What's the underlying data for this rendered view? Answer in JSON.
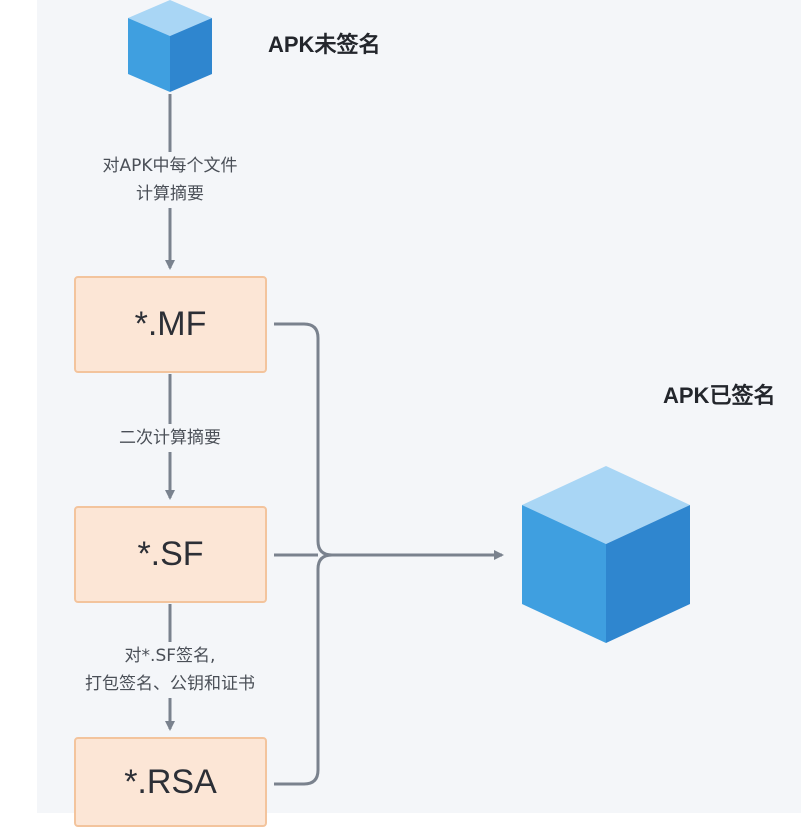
{
  "titles": {
    "unsigned": "APK未签名",
    "signed": "APK已签名"
  },
  "boxes": {
    "mf": "*.MF",
    "sf": "*.SF",
    "rsa": "*.RSA"
  },
  "steps": {
    "digest_line1": "对APK中每个文件",
    "digest_line2": "计算摘要",
    "second_digest": "二次计算摘要",
    "sign_line1": "对*.SF签名,",
    "sign_line2": "打包签名、公钥和证书"
  },
  "icons": {
    "unsigned": "cube-icon",
    "signed": "cube-icon"
  },
  "colors": {
    "box_fill": "#fce6d6",
    "box_border": "#f3c49d",
    "connector": "#7a828e",
    "cube_top": "#a9d6f5",
    "cube_left": "#3f9fe0",
    "cube_right": "#2f86cf"
  }
}
